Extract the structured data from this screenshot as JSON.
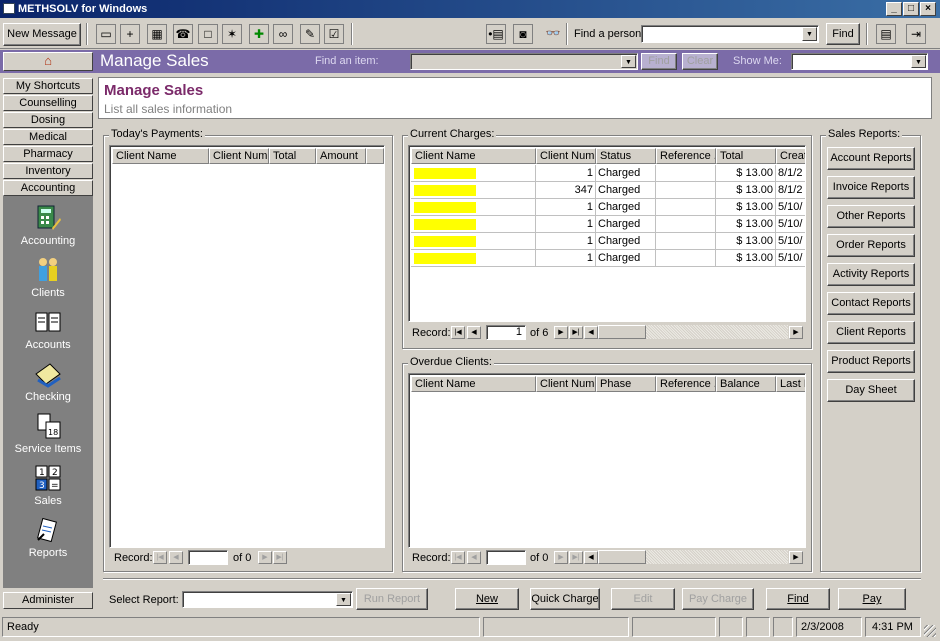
{
  "window": {
    "title": "METHSOLV for Windows"
  },
  "toolbar": {
    "new_message": "New Message",
    "find_person_label": "Find a person:",
    "find_person_value": "",
    "find_button": "Find"
  },
  "banner": {
    "home_icon": "home-icon",
    "title": "Manage Sales",
    "find_item_label": "Find an item:",
    "find_item_value": "",
    "find_button": "Find",
    "clear_button": "Clear",
    "show_me_label": "Show Me:",
    "show_me_value": ""
  },
  "nav": {
    "tabs": [
      "My Shortcuts",
      "Counselling",
      "Dosing",
      "Medical",
      "Pharmacy",
      "Inventory",
      "Accounting"
    ],
    "items": [
      {
        "label": "Accounting",
        "icon": "accounting-icon"
      },
      {
        "label": "Clients",
        "icon": "clients-icon"
      },
      {
        "label": "Accounts",
        "icon": "accounts-icon"
      },
      {
        "label": "Checking",
        "icon": "checking-icon"
      },
      {
        "label": "Service Items",
        "icon": "service-items-icon"
      },
      {
        "label": "Sales",
        "icon": "sales-icon"
      },
      {
        "label": "Reports",
        "icon": "reports-icon"
      }
    ],
    "administer": "Administer"
  },
  "header": {
    "title": "Manage Sales",
    "subtitle": "List all sales information"
  },
  "payments": {
    "label": "Today's Payments:",
    "columns": [
      "Client Name",
      "Client Num...",
      "Total",
      "Amount"
    ],
    "record_label": "Record:",
    "record_value": "",
    "record_of": "of 0"
  },
  "charges": {
    "label": "Current Charges:",
    "columns": [
      "Client Name",
      "Client Num...",
      "Status",
      "Reference ...",
      "Total",
      "Creat"
    ],
    "rows": [
      {
        "num": "1",
        "status": "Charged",
        "ref": "",
        "total": "$ 13.00",
        "created": "8/1/2"
      },
      {
        "num": "347",
        "status": "Charged",
        "ref": "",
        "total": "$ 13.00",
        "created": "8/1/2"
      },
      {
        "num": "1",
        "status": "Charged",
        "ref": "",
        "total": "$ 13.00",
        "created": "5/10/"
      },
      {
        "num": "1",
        "status": "Charged",
        "ref": "",
        "total": "$ 13.00",
        "created": "5/10/"
      },
      {
        "num": "1",
        "status": "Charged",
        "ref": "",
        "total": "$ 13.00",
        "created": "5/10/"
      },
      {
        "num": "1",
        "status": "Charged",
        "ref": "",
        "total": "$ 13.00",
        "created": "5/10/"
      }
    ],
    "record_label": "Record:",
    "record_value": "1",
    "record_of": "of 6"
  },
  "overdue": {
    "label": "Overdue Clients:",
    "columns": [
      "Client Name",
      "Client Num...",
      "Phase",
      "Reference ...",
      "Balance",
      "Last P"
    ],
    "record_label": "Record:",
    "record_value": "",
    "record_of": "of 0"
  },
  "reports": {
    "label": "Sales Reports:",
    "buttons": [
      "Account Reports",
      "Invoice Reports",
      "Other Reports",
      "Order Reports",
      "Activity Reports",
      "Contact Reports",
      "Client Reports",
      "Product Reports",
      "Day Sheet"
    ]
  },
  "bottom": {
    "select_report_label": "Select Report:",
    "select_report_value": "",
    "run_report": "Run Report",
    "new": "New",
    "quick_charge": "Quick Charge",
    "edit": "Edit",
    "pay_charge": "Pay Charge",
    "find": "Find",
    "pay": "Pay"
  },
  "status": {
    "text": "Ready",
    "date": "2/3/2008",
    "time": "4:31 PM"
  },
  "colors": {
    "title_bar": "#0a246a",
    "banner": "#7b6ba8",
    "highlight": "#ffff00",
    "header_title": "#7b2a6a"
  }
}
